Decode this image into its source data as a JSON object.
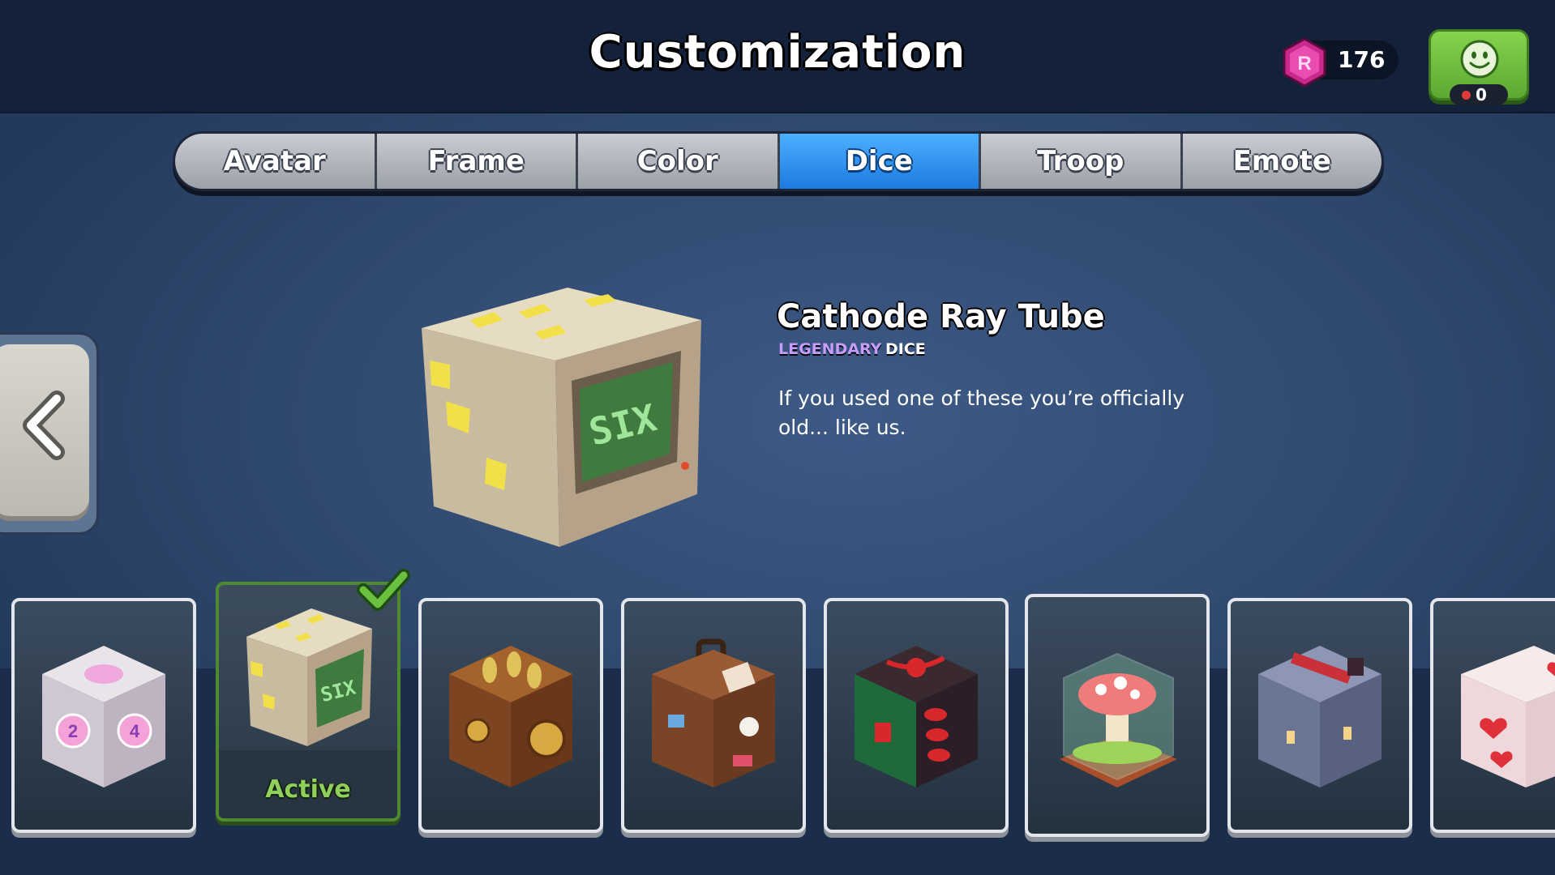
{
  "header": {
    "title": "Customization",
    "currency": {
      "icon": "gem-icon",
      "value": "176"
    },
    "profile": {
      "icon": "smiley-icon",
      "notification_count": "0"
    }
  },
  "tabs": [
    {
      "label": "Avatar",
      "active": false
    },
    {
      "label": "Frame",
      "active": false
    },
    {
      "label": "Color",
      "active": false
    },
    {
      "label": "Dice",
      "active": true
    },
    {
      "label": "Troop",
      "active": false
    },
    {
      "label": "Emote",
      "active": false
    }
  ],
  "featured": {
    "name": "Cathode Ray Tube",
    "rarity": "LEGENDARY",
    "type": "DICE",
    "description": "If you used one of these you’re officially old... like us."
  },
  "carousel": {
    "active_label": "Active",
    "items": [
      {
        "icon": "companion-cube-dice-icon"
      },
      {
        "icon": "crt-dice-icon",
        "state": "Active"
      },
      {
        "icon": "steampunk-dice-icon"
      },
      {
        "icon": "suitcase-dice-icon"
      },
      {
        "icon": "red-rope-dice-icon"
      },
      {
        "icon": "mushroom-dice-icon"
      },
      {
        "icon": "castle-dice-icon"
      },
      {
        "icon": "hearts-dice-icon"
      }
    ]
  },
  "colors": {
    "active_tab": "#2a90f0",
    "rarity_legendary": "#c69cff",
    "active_green": "#8fd05d"
  }
}
